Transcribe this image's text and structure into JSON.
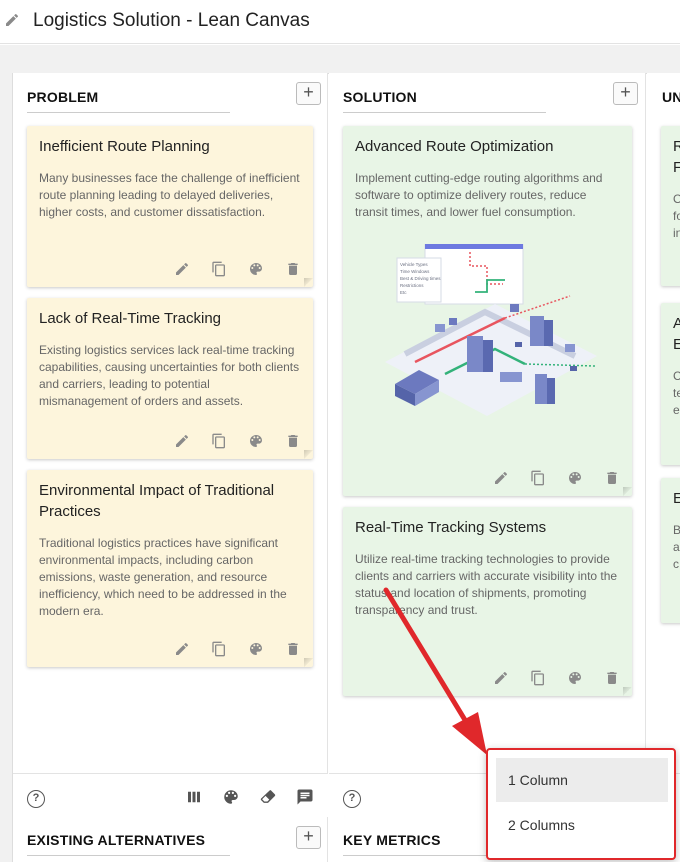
{
  "header": {
    "title": "Logistics Solution - Lean Canvas"
  },
  "columns": {
    "problem": {
      "title": "PROBLEM",
      "cards": [
        {
          "title": "Inefficient Route Planning",
          "body": "Many businesses face the challenge of inefficient route planning leading to delayed deliveries, higher costs, and customer dissatisfaction."
        },
        {
          "title": "Lack of Real-Time Tracking",
          "body": "Existing logistics services lack real-time tracking capabilities, causing uncertainties for both clients and carriers, leading to potential mismanagement of orders and assets."
        },
        {
          "title": "Environmental Impact of Traditional Practices",
          "body": "Traditional logistics practices have significant environmental impacts, including carbon emissions, waste generation, and resource inefficiency, which need to be addressed in the modern era."
        }
      ]
    },
    "solution": {
      "title": "SOLUTION",
      "cards": [
        {
          "title": "Advanced Route Optimization",
          "body": "Implement cutting-edge routing algorithms and software to optimize delivery routes, reduce transit times, and lower fuel consumption."
        },
        {
          "title": "Real-Time Tracking Systems",
          "body": "Utilize real-time tracking technologies to provide clients and carriers with accurate visibility into the status and location of shipments, promoting transparency and trust."
        }
      ],
      "illustration_menu": [
        "Vehicle Types",
        "Time Windows",
        "Best & Driving times",
        "Restrictions",
        "Etc"
      ]
    },
    "uvp": {
      "title": "UN",
      "cards": [
        {
          "line1": "R",
          "line2": "F",
          "body": [
            "O",
            "fo",
            "in"
          ]
        },
        {
          "line1": "A",
          "line2": "E",
          "body": [
            "C",
            "te",
            "e"
          ]
        },
        {
          "line1": "E",
          "body": [
            "B",
            "a",
            "c"
          ]
        }
      ]
    }
  },
  "row2": {
    "existing_alternatives": "EXISTING ALTERNATIVES",
    "key_metrics": "KEY METRICS"
  },
  "buttons": {
    "add": "+",
    "help": "?"
  },
  "dropdown": {
    "options": [
      "1 Column",
      "2 Columns"
    ],
    "selected": "1 Column"
  },
  "colors": {
    "card_yellow": "#fdf5dc",
    "card_green": "#e8f5e6",
    "highlight_red": "#e0282b"
  }
}
